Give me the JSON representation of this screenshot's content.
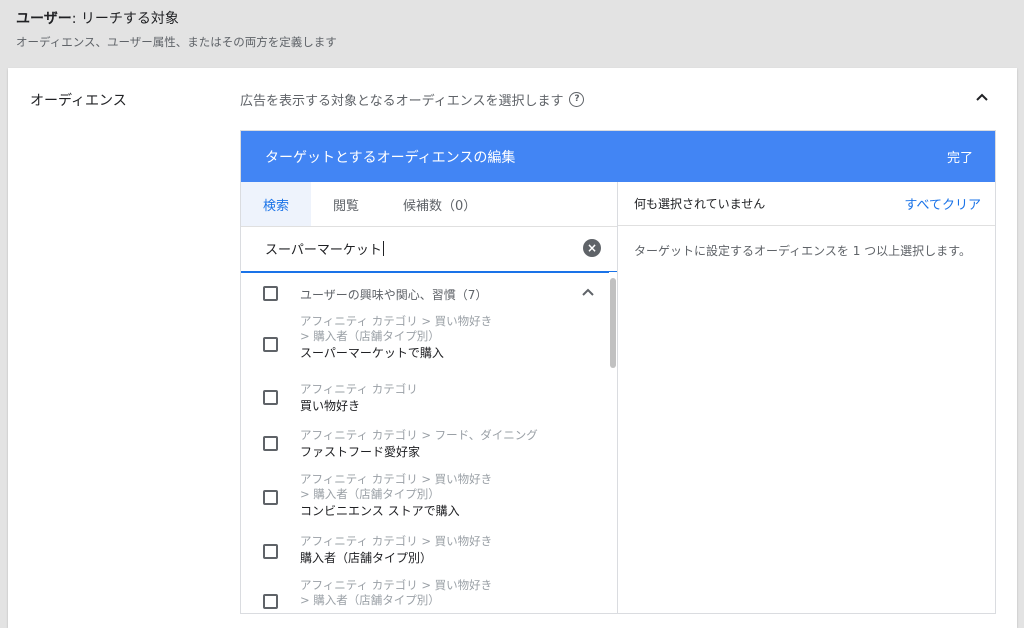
{
  "header": {
    "title_bold": "ユーザー",
    "title_rest": ": リーチする対象",
    "subtitle": "オーディエンス、ユーザー属性、またはその両方を定義します"
  },
  "section": {
    "label": "オーディエンス",
    "description": "広告を表示する対象となるオーディエンスを選択します",
    "help_icon": "help-circle-icon",
    "collapse_icon": "chevron-up-icon"
  },
  "editor": {
    "title": "ターゲットとするオーディエンスの編集",
    "done_label": "完了",
    "accent_color": "#4285f4",
    "tabs": [
      {
        "label": "検索",
        "active": true
      },
      {
        "label": "閲覧",
        "active": false
      },
      {
        "label": "候補数（0）",
        "active": false
      }
    ],
    "search": {
      "value": "スーパーマーケット",
      "clear_icon": "clear-icon"
    },
    "group": {
      "label": "ユーザーの興味や関心、習慣（7）"
    },
    "items": [
      {
        "path1": "アフィニティ カテゴリ > 買い物好き",
        "path2": " > 購入者（店舗タイプ別）",
        "name": "スーパーマーケットで購入"
      },
      {
        "path1": "アフィニティ カテゴリ",
        "path2": "",
        "name": "買い物好き"
      },
      {
        "path1": "アフィニティ カテゴリ > フード、ダイニング",
        "path2": "",
        "name": "ファストフード愛好家"
      },
      {
        "path1": "アフィニティ カテゴリ > 買い物好き",
        "path2": " > 購入者（店舗タイプ別）",
        "name": "コンビニエンス ストアで購入"
      },
      {
        "path1": "アフィニティ カテゴリ > 買い物好き",
        "path2": "",
        "name": "購入者（店舗タイプ別）"
      },
      {
        "path1": "アフィニティ カテゴリ > 買い物好き",
        "path2": " > 購入者（店舗タイプ別）",
        "name": ""
      }
    ],
    "right": {
      "status": "何も選択されていません",
      "clear_all": "すべてクリア",
      "hint": "ターゲットに設定するオーディエンスを 1 つ以上選択します。"
    }
  }
}
